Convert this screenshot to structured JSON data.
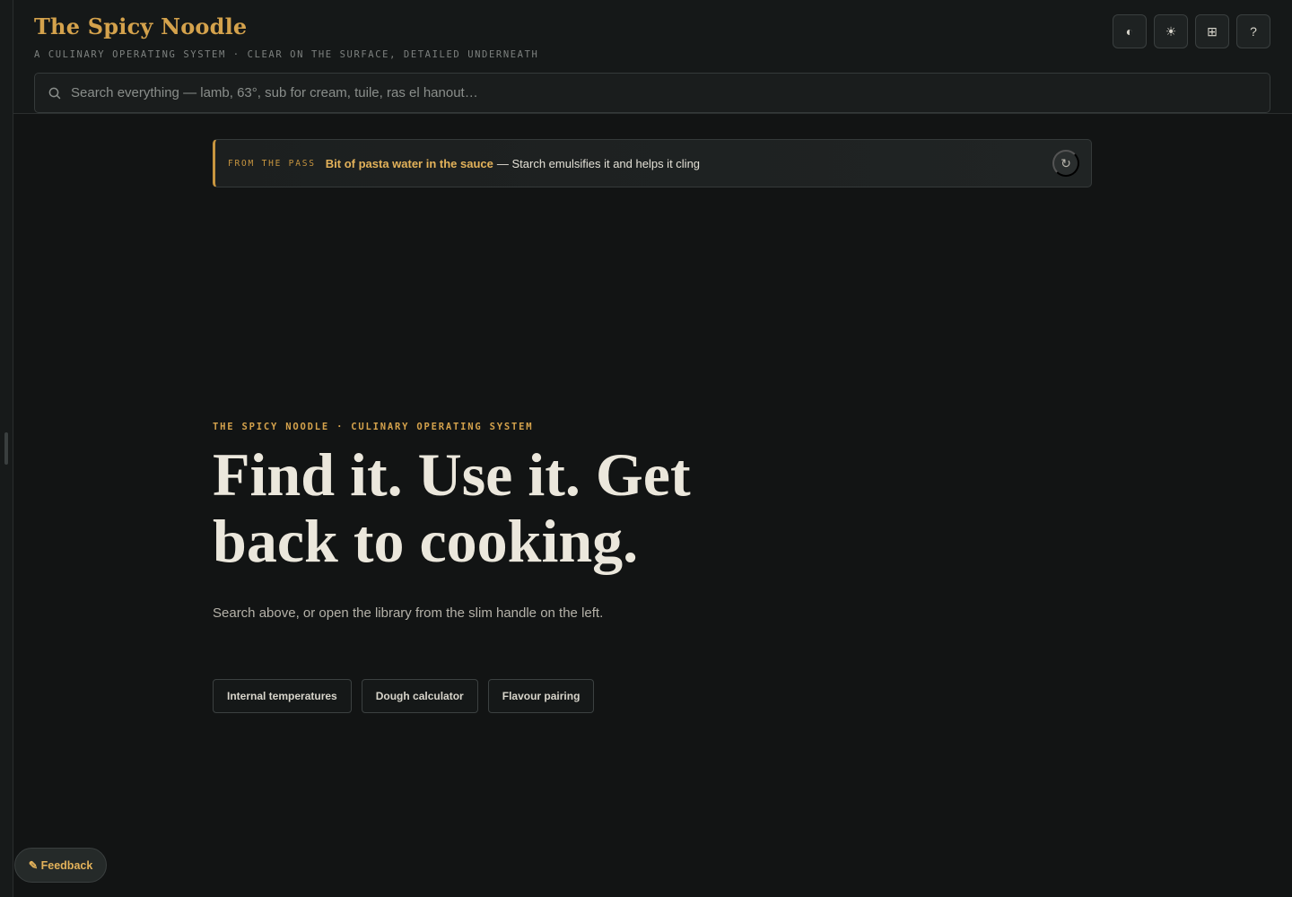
{
  "brand": {
    "title": "The Spicy Noodle",
    "tagline": "A CULINARY OPERATING SYSTEM · CLEAR ON THE SURFACE, DETAILED UNDERNEATH"
  },
  "toolbar": {
    "contrast_icon": "◐",
    "theme_icon": "☀",
    "layout_icon": "⊞",
    "help_icon": "?"
  },
  "search": {
    "placeholder": "Search everything — lamb, 63°, sub for cream, tuile, ras el hanout…",
    "value": ""
  },
  "tip": {
    "tag": "FROM THE PASS",
    "title": "Bit of pasta water in the sauce",
    "body": "— Starch emulsifies it and helps it cling",
    "refresh_icon": "↻"
  },
  "hero": {
    "eyebrow": "THE SPICY NOODLE · CULINARY OPERATING SYSTEM",
    "headline": "Find it. Use it. Get back to cooking.",
    "subline": "Search above, or open the library from the slim handle on the left."
  },
  "quick_links": [
    {
      "label": "Internal temperatures"
    },
    {
      "label": "Dough calculator"
    },
    {
      "label": "Flavour pairing"
    }
  ],
  "feedback": {
    "label": "✎ Feedback"
  },
  "colors": {
    "accent": "#d4a24c",
    "background": "#121414",
    "text": "#ebe7dc"
  }
}
